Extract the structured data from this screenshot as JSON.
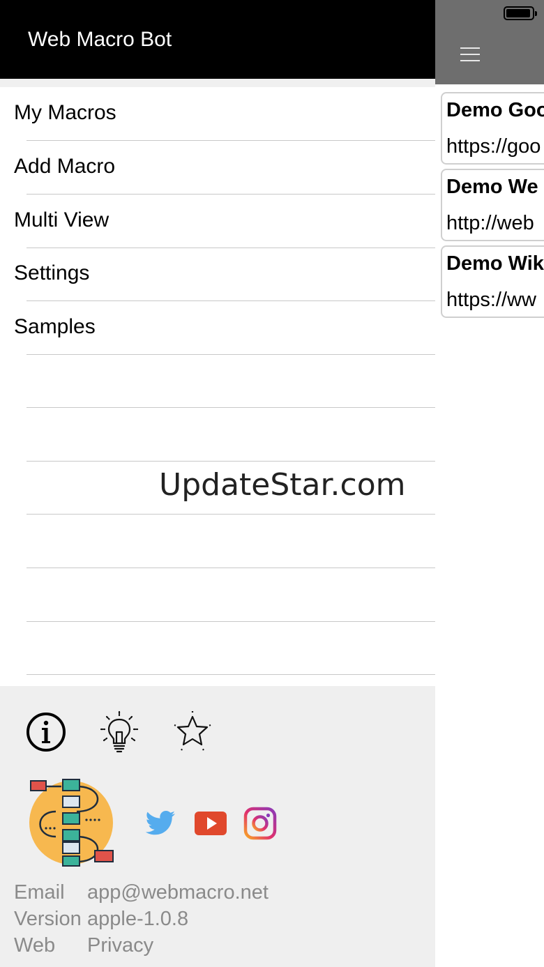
{
  "drawer": {
    "title": "Web Macro Bot",
    "menu": [
      {
        "label": "My Macros"
      },
      {
        "label": "Add Macro"
      },
      {
        "label": "Multi View"
      },
      {
        "label": "Settings"
      },
      {
        "label": "Samples"
      }
    ],
    "watermark": "UpdateStar.com",
    "footer": {
      "action_icons": [
        "info-icon",
        "lightbulb-icon",
        "star-icon"
      ],
      "social_icons": [
        "twitter-icon",
        "youtube-icon",
        "instagram-icon"
      ],
      "info": {
        "email_label": "Email",
        "email_value": "app@webmacro.net",
        "version_label": "Version",
        "version_value": "apple-1.0.8",
        "web_label": "Web",
        "web_value": "Privacy"
      }
    }
  },
  "main": {
    "menu_icon": "hamburger-icon",
    "status_icon": "battery-icon",
    "macros": [
      {
        "name": "Demo Goo",
        "url": "https://goo"
      },
      {
        "name": "Demo We",
        "url": "http://web"
      },
      {
        "name": "Demo Wik",
        "url": "https://ww"
      }
    ]
  },
  "colors": {
    "drawer_header": "#000000",
    "main_header": "#6e6e6e",
    "footer_bg": "#efefef",
    "muted_text": "#8a8a8a",
    "twitter": "#55acee",
    "youtube": "#e0482c",
    "logo_circle": "#f7b84f"
  }
}
